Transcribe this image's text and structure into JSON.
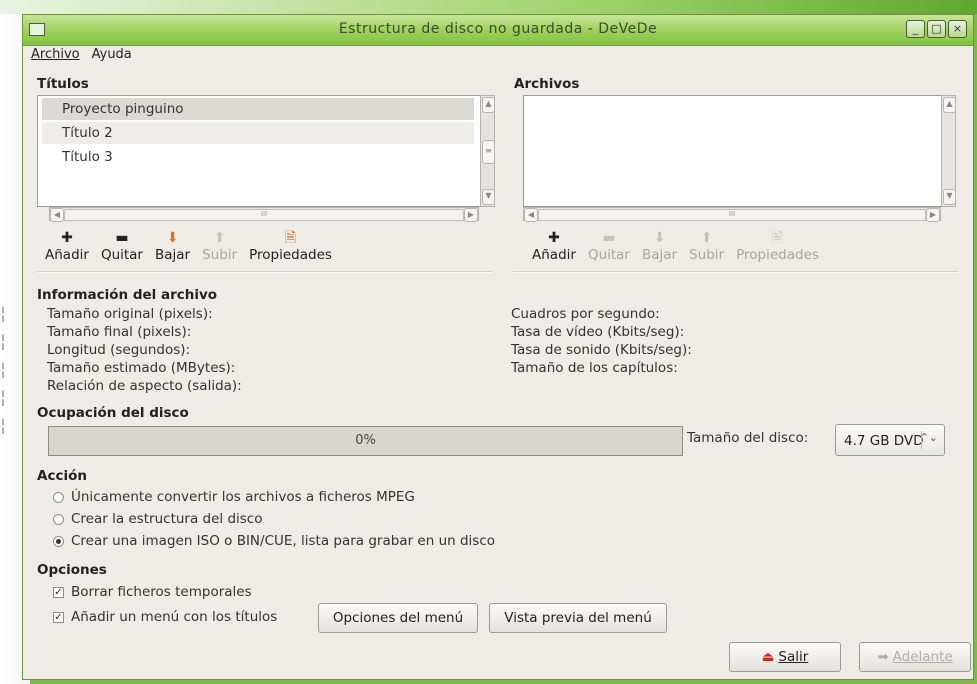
{
  "window": {
    "title": "Estructura de disco no guardada - DeVeDe"
  },
  "menu": {
    "archivo": "Archivo",
    "ayuda": "Ayuda"
  },
  "titles_panel": {
    "label": "Títulos",
    "items": [
      "Proyecto pinguino",
      "Título 2",
      "Título 3"
    ],
    "toolbar": {
      "add": "Añadir",
      "remove": "Quitar",
      "down": "Bajar",
      "up": "Subir",
      "props": "Propiedades"
    }
  },
  "files_panel": {
    "label": "Archivos",
    "items": [],
    "toolbar": {
      "add": "Añadir",
      "remove": "Quitar",
      "down": "Bajar",
      "up": "Subir",
      "props": "Propiedades"
    }
  },
  "file_info": {
    "label": "Información del archivo",
    "left": [
      "Tamaño original (pixels):",
      "Tamaño final (pixels):",
      "Longitud (segundos):",
      "Tamaño estimado (MBytes):",
      "Relación de aspecto (salida):"
    ],
    "right": [
      "Cuadros por segundo:",
      "Tasa de vídeo (Kbits/seg):",
      "Tasa de sonido (Kbits/seg):",
      "Tamaño de los capítulos:"
    ]
  },
  "disk": {
    "label": "Ocupación del disco",
    "usage_text": "0%",
    "usage_fraction": 0,
    "size_label": "Tamaño del disco:",
    "size_value": "4.7 GB DVD"
  },
  "action": {
    "label": "Acción",
    "options": [
      "Únicamente convertir los archivos a ficheros MPEG",
      "Crear la estructura del disco",
      "Crear una imagen ISO o BIN/CUE, lista para grabar en un disco"
    ],
    "selected_index": 2
  },
  "options": {
    "label": "Opciones",
    "delete_temp": "Borrar ficheros temporales",
    "add_menu": "Añadir un menú con los títulos",
    "menu_options_button": "Opciones del menú",
    "menu_preview_button": "Vista previa del menú"
  },
  "footer": {
    "exit": "Salir",
    "next": "Adelante"
  }
}
